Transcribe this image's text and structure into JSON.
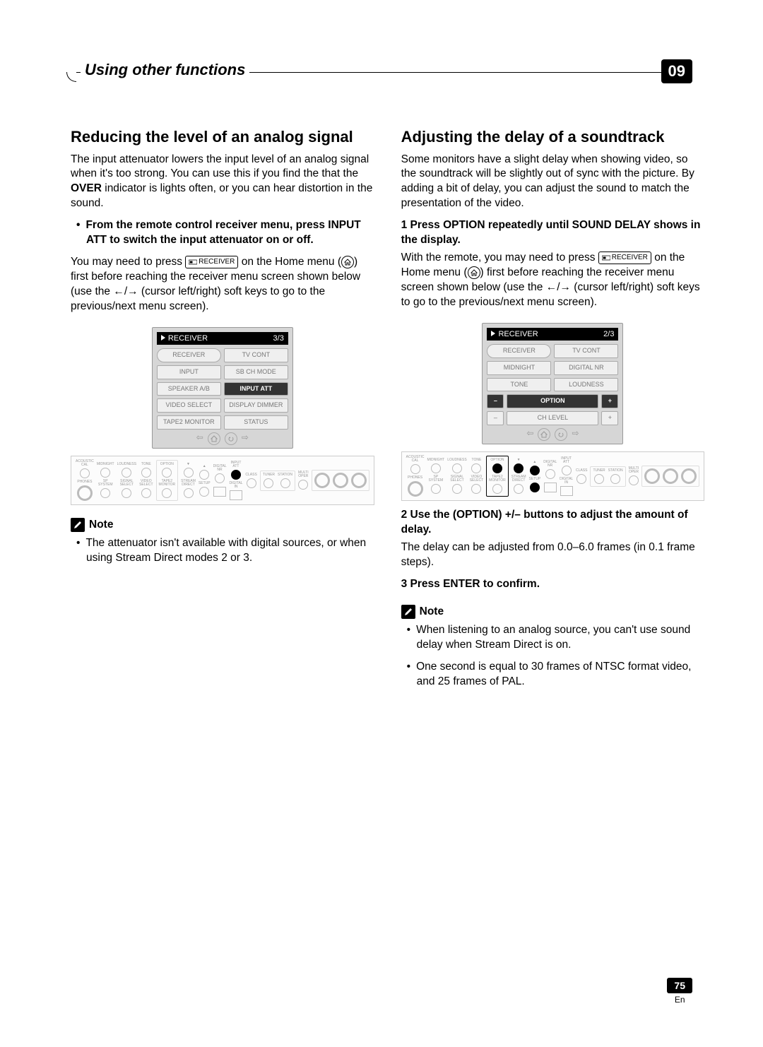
{
  "header": {
    "title": "Using other functions",
    "chapter": "09"
  },
  "left": {
    "h": "Reducing the level of an analog signal",
    "p1a": "The input attenuator lowers the input level of an analog signal when it's too strong. You can use this if you find the that the ",
    "p1b": "OVER",
    "p1c": " indicator is lights often, or you can hear distortion in the sound.",
    "bullet": "From the remote control receiver menu, press INPUT ATT to switch the input attenuator on or off.",
    "p2a": "You may need to press ",
    "receiver_key": "RECEIVER",
    "p2b": " on the Home menu (",
    "p2c": ") first before reaching the receiver menu screen shown below (use the ",
    "p2d": " (cursor left/right) soft keys to go to the previous/next menu screen).",
    "osd": {
      "title": "RECEIVER",
      "page": "3/3",
      "btns": [
        {
          "label": "RECEIVER",
          "cls": "pill"
        },
        {
          "label": "TV CONT",
          "cls": ""
        },
        {
          "label": "INPUT",
          "cls": ""
        },
        {
          "label": "SB CH MODE",
          "cls": ""
        },
        {
          "label": "SPEAKER A/B",
          "cls": ""
        },
        {
          "label": "INPUT ATT",
          "cls": "dark"
        },
        {
          "label": "VIDEO SELECT",
          "cls": ""
        },
        {
          "label": "DISPLAY DIMMER",
          "cls": ""
        },
        {
          "label": "TAPE2 MONITOR",
          "cls": ""
        },
        {
          "label": "STATUS",
          "cls": ""
        }
      ]
    },
    "panel_highlight": "INPUT ATT",
    "note_label": "Note",
    "note1": "The attenuator isn't available with digital sources, or when using Stream Direct modes 2 or 3."
  },
  "right": {
    "h": "Adjusting the delay of a soundtrack",
    "p1": "Some monitors have a slight delay when showing video, so the soundtrack will be slightly out of sync with the picture. By adding a bit of delay, you can adjust the sound to match the presentation of the video.",
    "step1": "1    Press OPTION repeatedly until SOUND DELAY shows in the display.",
    "p2a": "With the remote, you may need to press ",
    "receiver_key": "RECEIVER",
    "p2b": " on the Home menu (",
    "p2c": ") first before reaching the receiver menu screen shown below (use the ",
    "p2d": " (cursor left/right) soft keys to go to the previous/next menu screen).",
    "osd": {
      "title": "RECEIVER",
      "page": "2/3",
      "btns": [
        {
          "label": "RECEIVER",
          "cls": "pill"
        },
        {
          "label": "TV CONT",
          "cls": ""
        },
        {
          "label": "MIDNIGHT",
          "cls": ""
        },
        {
          "label": "DIGITAL NR",
          "cls": ""
        },
        {
          "label": "TONE",
          "cls": ""
        },
        {
          "label": "LOUDNESS",
          "cls": ""
        },
        {
          "label": "–",
          "cls": "dark sm"
        },
        {
          "label": "OPTION",
          "cls": "dark"
        },
        {
          "label": "+",
          "cls": "dark sm"
        },
        {
          "label": "–",
          "cls": "sm"
        },
        {
          "label": "CH LEVEL",
          "cls": ""
        },
        {
          "label": "+",
          "cls": "sm"
        }
      ]
    },
    "panel_highlight": "OPTION",
    "step2": "2    Use the (OPTION) +/– buttons to adjust the amount of delay.",
    "p3": "The delay can be adjusted from 0.0–6.0 frames (in 0.1 frame steps).",
    "step3": "3    Press ENTER to confirm.",
    "note_label": "Note",
    "note1": "When listening to an analog source, you can't use sound delay when Stream Direct is on.",
    "note2": "One second is equal to 30 frames of NTSC format video, and 25 frames of PAL."
  },
  "footer": {
    "page": "75",
    "lang": "En"
  }
}
